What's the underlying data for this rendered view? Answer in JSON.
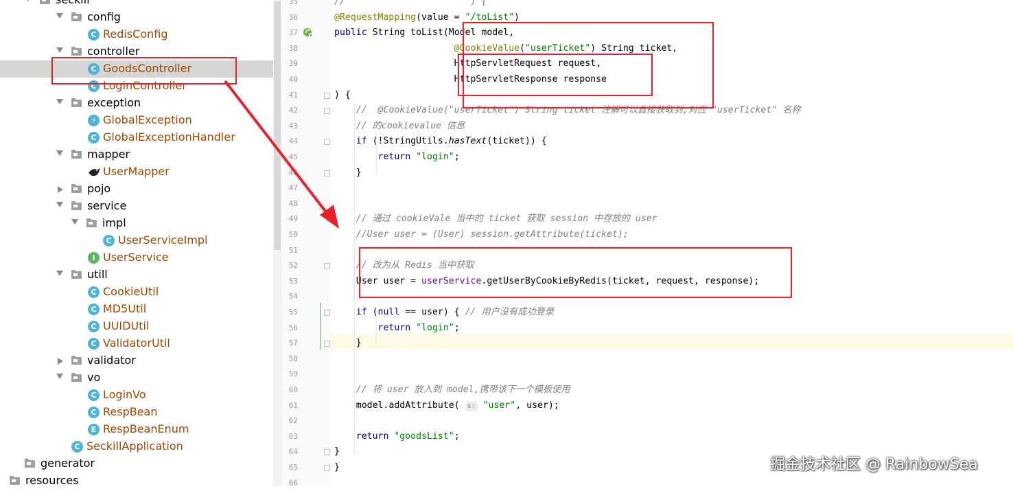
{
  "project_tree": {
    "items": [
      {
        "label": "seckill",
        "kind": "package",
        "expanded": true,
        "level": 0
      },
      {
        "label": "config",
        "kind": "package",
        "expanded": true,
        "level": 1
      },
      {
        "label": "RedisConfig",
        "kind": "class",
        "level": 2
      },
      {
        "label": "controller",
        "kind": "package",
        "expanded": true,
        "level": 1
      },
      {
        "label": "GoodsController",
        "kind": "class",
        "level": 2,
        "selected": true
      },
      {
        "label": "LoginController",
        "kind": "class",
        "level": 2
      },
      {
        "label": "exception",
        "kind": "package",
        "expanded": true,
        "level": 1
      },
      {
        "label": "GlobalException",
        "kind": "exception",
        "level": 2
      },
      {
        "label": "GlobalExceptionHandler",
        "kind": "class",
        "level": 2
      },
      {
        "label": "mapper",
        "kind": "package",
        "expanded": true,
        "level": 1
      },
      {
        "label": "UserMapper",
        "kind": "mapper",
        "level": 2
      },
      {
        "label": "pojo",
        "kind": "package",
        "expanded": false,
        "level": 1
      },
      {
        "label": "service",
        "kind": "package",
        "expanded": true,
        "level": 1
      },
      {
        "label": "impl",
        "kind": "package",
        "expanded": true,
        "level": 2
      },
      {
        "label": "UserServiceImpl",
        "kind": "class",
        "level": 3
      },
      {
        "label": "UserService",
        "kind": "interface",
        "level": 2
      },
      {
        "label": "utill",
        "kind": "package",
        "expanded": true,
        "level": 1
      },
      {
        "label": "CookieUtil",
        "kind": "class",
        "level": 2
      },
      {
        "label": "MD5Util",
        "kind": "class",
        "level": 2
      },
      {
        "label": "UUIDUtil",
        "kind": "class",
        "level": 2
      },
      {
        "label": "ValidatorUtil",
        "kind": "class",
        "level": 2
      },
      {
        "label": "validator",
        "kind": "package",
        "expanded": false,
        "level": 1
      },
      {
        "label": "vo",
        "kind": "package",
        "expanded": true,
        "level": 1
      },
      {
        "label": "LoginVo",
        "kind": "class",
        "level": 2
      },
      {
        "label": "RespBean",
        "kind": "class",
        "level": 2
      },
      {
        "label": "RespBeanEnum",
        "kind": "enum",
        "level": 2
      },
      {
        "label": "SeckillApplication",
        "kind": "app",
        "level": 1
      },
      {
        "label": "generator",
        "kind": "folder",
        "level": 0
      },
      {
        "label": "resources",
        "kind": "folder",
        "level": -1
      }
    ]
  },
  "editor": {
    "lines": [
      {
        "n": "35",
        "parts": [
          [
            "cm",
            "//                       ) {"
          ]
        ]
      },
      {
        "n": "36",
        "parts": [
          [
            "an",
            "@RequestMapping"
          ],
          [
            "",
            "(value = "
          ],
          [
            "str",
            "\"/toList\""
          ],
          [
            "",
            ")"
          ]
        ]
      },
      {
        "n": "37",
        "parts": [
          [
            "kw",
            "public"
          ],
          [
            "",
            " String "
          ],
          [
            "",
            "toList(Model model,"
          ]
        ]
      },
      {
        "n": "38",
        "parts": [
          [
            "",
            "                      "
          ],
          [
            "an",
            "@CookieValue"
          ],
          [
            "",
            "("
          ],
          [
            "str",
            "\"userTicket\""
          ],
          [
            "",
            ") String ticket,"
          ]
        ]
      },
      {
        "n": "39",
        "parts": [
          [
            "",
            "                      HttpServletRequest request,"
          ]
        ]
      },
      {
        "n": "40",
        "parts": [
          [
            "",
            "                      HttpServletResponse response"
          ]
        ]
      },
      {
        "n": "41",
        "parts": [
          [
            "",
            ") {"
          ]
        ]
      },
      {
        "n": "42",
        "parts": [
          [
            "cm",
            "    //  @CookieValue(\"userTicket\") String ticket 注解可以直接获取到,对应 \"userTicket\" 名称"
          ]
        ]
      },
      {
        "n": "43",
        "parts": [
          [
            "cm",
            "    // 的cookievalue 信息"
          ]
        ]
      },
      {
        "n": "44",
        "parts": [
          [
            "",
            "    "
          ],
          [
            "kw",
            "if"
          ],
          [
            "",
            " (!StringUtils."
          ],
          [
            "mth",
            "hasText"
          ],
          [
            "",
            "(ticket)) {"
          ]
        ]
      },
      {
        "n": "45",
        "parts": [
          [
            "",
            "        "
          ],
          [
            "kw",
            "return"
          ],
          [
            "",
            " "
          ],
          [
            "str",
            "\"login\""
          ],
          [
            "",
            ";"
          ]
        ]
      },
      {
        "n": "46",
        "parts": [
          [
            "",
            "    }"
          ]
        ]
      },
      {
        "n": "47",
        "parts": []
      },
      {
        "n": "48",
        "parts": []
      },
      {
        "n": "49",
        "parts": [
          [
            "cm",
            "    // 通过 cookieVale 当中的 ticket 获取 session 中存放的 user"
          ]
        ]
      },
      {
        "n": "50",
        "parts": [
          [
            "cm",
            "    //User user = (User) session.getAttribute(ticket);"
          ]
        ]
      },
      {
        "n": "51",
        "parts": []
      },
      {
        "n": "52",
        "parts": [
          [
            "cm",
            "    // 改为从 Redis 当中获取"
          ]
        ]
      },
      {
        "n": "53",
        "parts": [
          [
            "",
            "    User user = "
          ],
          [
            "fld",
            "userService"
          ],
          [
            "",
            ".getUserByCookieByRedis(ticket, request, response);"
          ]
        ]
      },
      {
        "n": "54",
        "parts": []
      },
      {
        "n": "55",
        "parts": [
          [
            "",
            "    "
          ],
          [
            "kw",
            "if"
          ],
          [
            "",
            " ("
          ],
          [
            "kw",
            "null"
          ],
          [
            "",
            " == user) { "
          ],
          [
            "cm",
            "// 用户没有成功登录"
          ]
        ]
      },
      {
        "n": "56",
        "parts": [
          [
            "",
            "        "
          ],
          [
            "kw",
            "return"
          ],
          [
            "",
            " "
          ],
          [
            "str",
            "\"login\""
          ],
          [
            "",
            ";"
          ]
        ]
      },
      {
        "n": "57",
        "parts": [
          [
            "",
            "    }"
          ]
        ]
      },
      {
        "n": "58",
        "parts": []
      },
      {
        "n": "59",
        "parts": []
      },
      {
        "n": "60",
        "parts": [
          [
            "cm",
            "    // 将 user 放入到 model,携带该下一个模板使用"
          ]
        ]
      },
      {
        "n": "61",
        "parts": [
          [
            "",
            "    model.addAttribute( "
          ],
          [
            "hint",
            "s:"
          ],
          [
            "",
            " "
          ],
          [
            "str",
            "\"user\""
          ],
          [
            "",
            ", user);"
          ]
        ]
      },
      {
        "n": "62",
        "parts": []
      },
      {
        "n": "63",
        "parts": [
          [
            "",
            "    "
          ],
          [
            "kw",
            "return"
          ],
          [
            "",
            " "
          ],
          [
            "str",
            "\"goodsList\""
          ],
          [
            "",
            ";"
          ]
        ]
      },
      {
        "n": "64",
        "parts": [
          [
            "",
            "}"
          ]
        ]
      },
      {
        "n": "65",
        "parts": [
          [
            "",
            "}"
          ]
        ]
      },
      {
        "n": "66",
        "parts": []
      }
    ]
  },
  "watermark": "掘金技术社区 @ RainbowSea",
  "colors": {
    "annotation_red": "#e8202a",
    "selected_row": "#d5d5d5",
    "class_label": "#9c4800",
    "keyword": "#000080",
    "string": "#008000",
    "annotation": "#808000",
    "comment": "#808080"
  }
}
